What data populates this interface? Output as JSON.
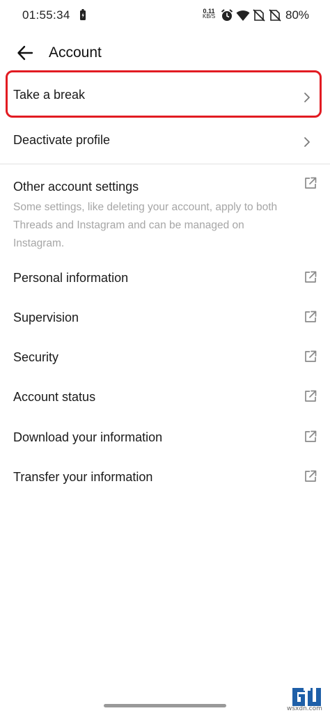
{
  "status_bar": {
    "time": "01:55:34",
    "net_speed_value": "0.11",
    "net_speed_unit": "KB/S",
    "battery": "80%",
    "icons": [
      "battery-saver-icon",
      "alarm-icon",
      "wifi-icon",
      "no-sim-icon",
      "no-sim-icon"
    ]
  },
  "header": {
    "title": "Account"
  },
  "rows": {
    "take_break": "Take a break",
    "deactivate": "Deactivate profile",
    "other_settings": "Other account settings",
    "other_settings_desc": "Some settings, like deleting your account, apply to both Threads and Instagram and can be managed on Instagram.",
    "personal_info": "Personal information",
    "supervision": "Supervision",
    "security": "Security",
    "account_status": "Account status",
    "download_info": "Download your information",
    "transfer_info": "Transfer your information"
  },
  "watermark": {
    "site": "wsxdn.com"
  },
  "colors": {
    "highlight": "#e21b22",
    "secondary_text": "#a6a6a6",
    "icon_gray": "#8a8a8a"
  }
}
